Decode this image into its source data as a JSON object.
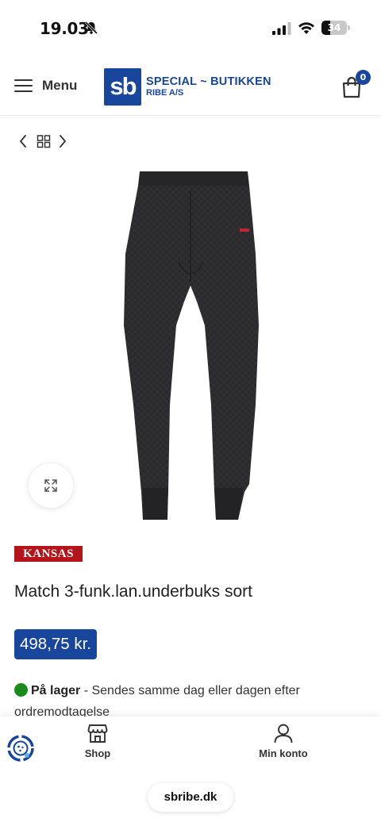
{
  "status_bar": {
    "time": "19.03",
    "battery_level": "34",
    "icons": [
      "bell-slash-icon",
      "signal-icon",
      "wifi-icon",
      "battery-icon"
    ]
  },
  "header": {
    "menu_label": "Menu",
    "logo": {
      "mark": "sb",
      "line1": "SPECIAL ~ BUTIKKEN",
      "line2": "RIBE A/S"
    },
    "cart_count": "0",
    "brand_color": "#17469c"
  },
  "product": {
    "brand": "KANSAS",
    "brand_color": "#b5141a",
    "title": "Match 3-funk.lan.underbuks sort",
    "price": "498,75 kr.",
    "stock_label": "På lager",
    "stock_separator": " - ",
    "stock_text": "Sendes samme dag eller dagen efter ordremodtagelse",
    "stock_color": "#1a8a1a"
  },
  "bottom_nav": {
    "shop_label": "Shop",
    "account_label": "Min konto",
    "url": "sbribe.dk"
  }
}
